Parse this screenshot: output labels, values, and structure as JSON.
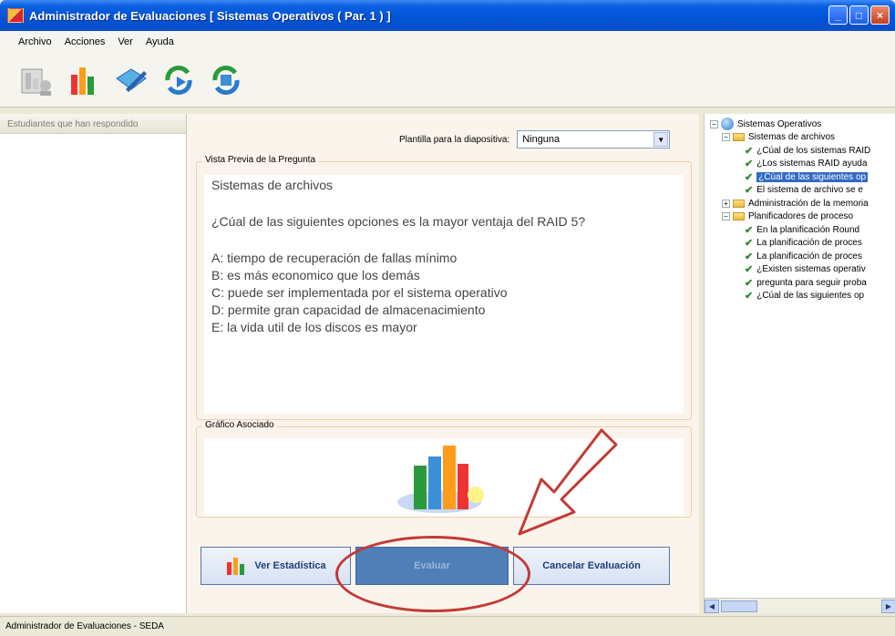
{
  "window": {
    "title": "Administrador de Evaluaciones [ Sistemas Operativos ( Par. 1 ) ]"
  },
  "menu": [
    "Archivo",
    "Acciones",
    "Ver",
    "Ayuda"
  ],
  "toolbar": {
    "icons": [
      "users-chart-icon",
      "bar-chart-icon",
      "edit-book-icon",
      "refresh-play-icon",
      "refresh-arrows-icon"
    ]
  },
  "left_panel": {
    "header": "Estudiantes que han respondido"
  },
  "center": {
    "plantilla_label": "Plantilla para la diapositiva:",
    "plantilla_value": "Ninguna",
    "preview_legend": "Vista Previa de la Pregunta",
    "preview": {
      "topic": "Sistemas de archivos",
      "question": "¿Cúal de las siguientes opciones es la mayor ventaja del RAID 5?",
      "options": [
        "A: tiempo de recuperación de fallas mínimo",
        "B: es más economico que los demás",
        "C: puede ser implementada por el sistema operativo",
        "D: permite gran capacidad de almacenacimiento",
        "E: la vida util de los discos es mayor"
      ]
    },
    "chart_legend": "Gráfico Asociado",
    "buttons": {
      "ver": "Ver Estadística",
      "evaluar": "Evaluar",
      "cancelar": "Cancelar Evaluación"
    }
  },
  "tree": [
    {
      "level": 0,
      "type": "root",
      "expander": "−",
      "label": "Sistemas Operativos"
    },
    {
      "level": 1,
      "type": "folder",
      "expander": "−",
      "label": "Sistemas de archivos"
    },
    {
      "level": 2,
      "type": "item",
      "label": "¿Cúal de los sistemas RAID"
    },
    {
      "level": 2,
      "type": "item",
      "label": "¿Los sistemas RAID ayuda"
    },
    {
      "level": 2,
      "type": "item",
      "label": "¿Cúal de las siguientes op",
      "selected": true
    },
    {
      "level": 2,
      "type": "item",
      "label": "El sistema de archivo se e"
    },
    {
      "level": 1,
      "type": "folder",
      "expander": "+",
      "label": "Administración de la memoria"
    },
    {
      "level": 1,
      "type": "folder",
      "expander": "−",
      "label": "Planificadores de proceso"
    },
    {
      "level": 2,
      "type": "item",
      "label": "En la planificación Round"
    },
    {
      "level": 2,
      "type": "item",
      "label": "La planificación de proces"
    },
    {
      "level": 2,
      "type": "item",
      "label": "La planificación de proces"
    },
    {
      "level": 2,
      "type": "item",
      "label": "¿Existen sistemas operativ"
    },
    {
      "level": 2,
      "type": "item",
      "label": "pregunta para seguir proba"
    },
    {
      "level": 2,
      "type": "item",
      "label": "¿Cúal de las siguientes op"
    }
  ],
  "status": "Administrador de Evaluaciones - SEDA",
  "colors": {
    "title_bar": "#0053d6",
    "highlight": "#c23a35",
    "selected": "#316ac5"
  }
}
